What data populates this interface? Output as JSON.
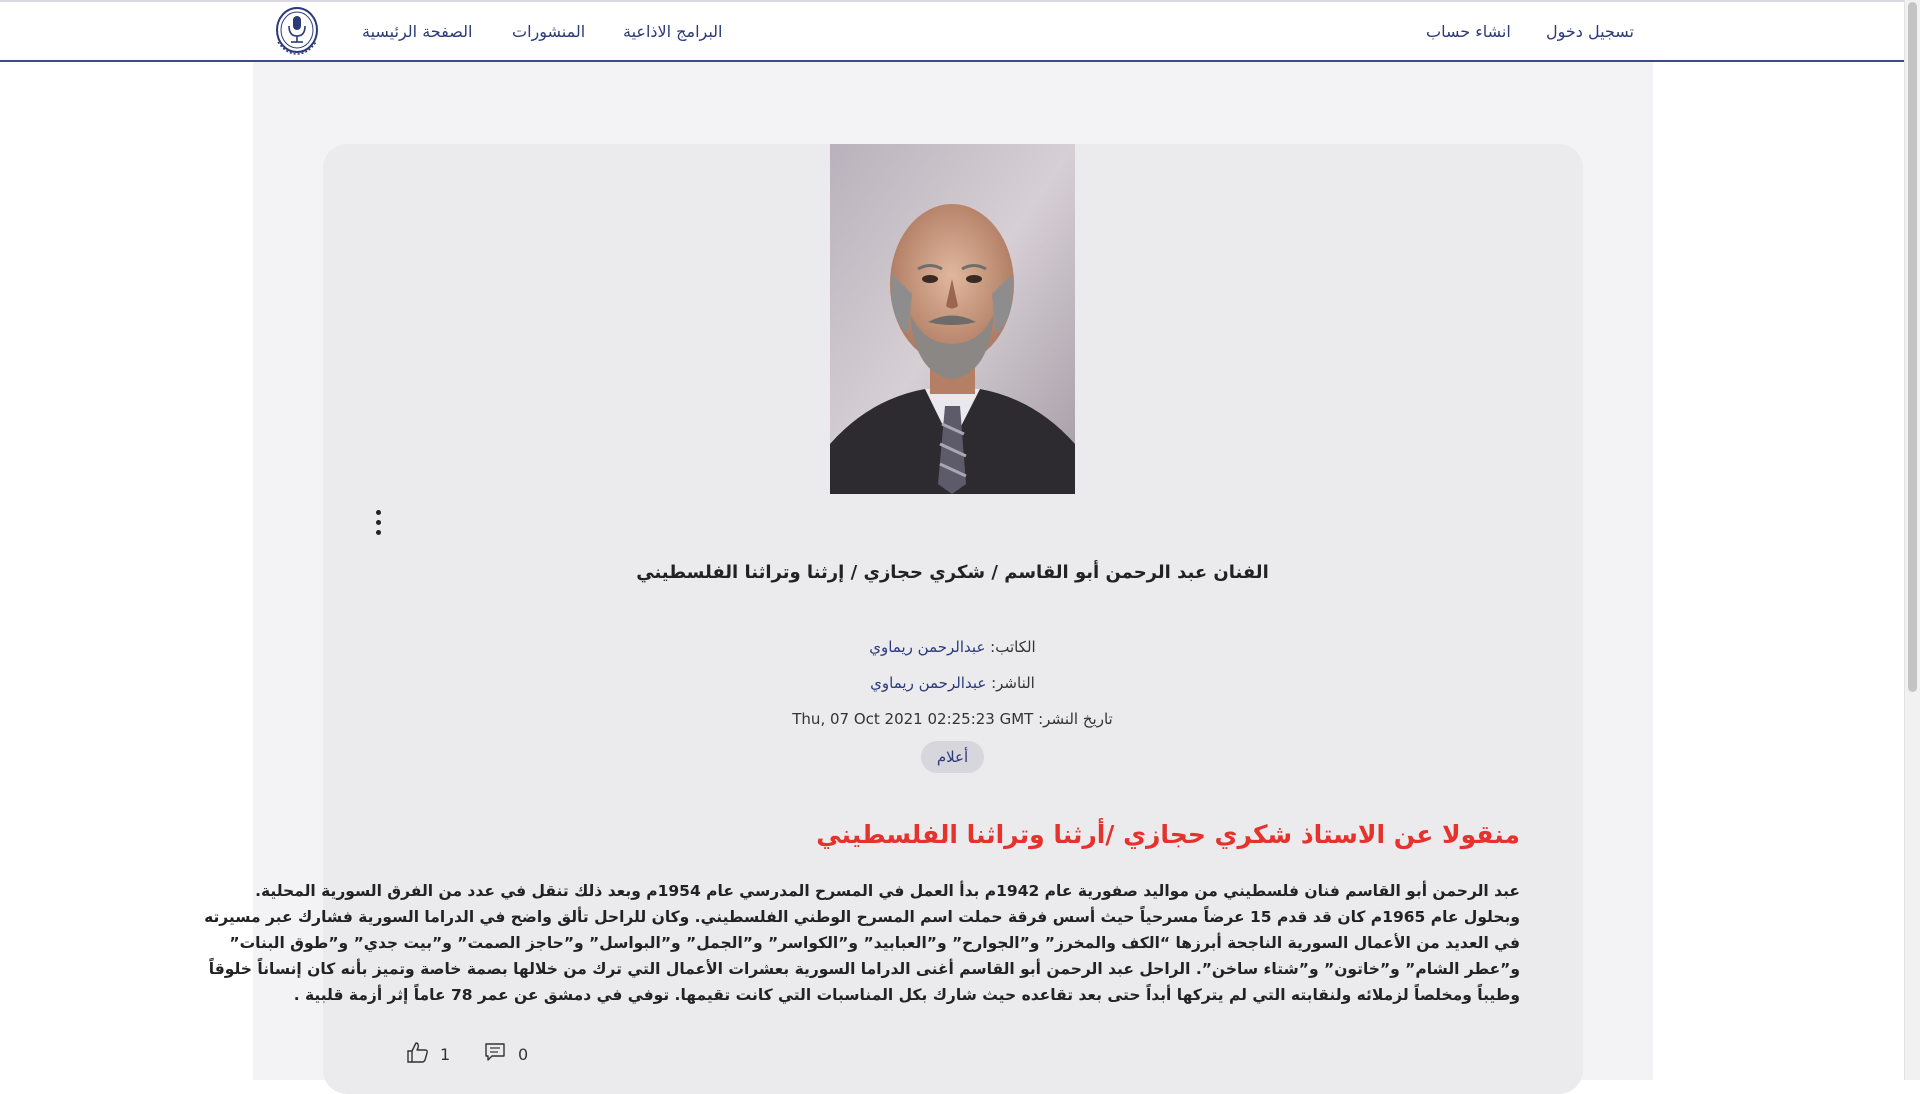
{
  "nav": {
    "home": "الصفحة الرئيسية",
    "posts": "المنشورات",
    "radio": "البرامج الاذاعية",
    "signup": "انشاء حساب",
    "login": "تسجيل دخول",
    "logo_icon": "radio-microphone-emblem-icon"
  },
  "post": {
    "title": "الفنان عبد الرحمن أبو القاسم / شكري حجازي / إرثنا وتراثنا الفلسطيني",
    "author_label": "الكاتب:",
    "author_name": "عبدالرحمن ريماوي",
    "publisher_label": "الناشر:",
    "publisher_name": "عبدالرحمن ريماوي",
    "date_label": "تاريخ النشر:",
    "date_value": "Thu, 07 Oct 2021 02:25:23 GMT",
    "tag": "أعلام",
    "headline": "منقولا عن الاستاذ شكري حجازي /أرثنا وتراثنا الفلسطيني",
    "body_lines": [
      "عبد الرحمن أبو القاسم فنان فلسطيني من مواليد صفورية عام 1942م بدأ العمل في المسرح المدرسي عام 1954م وبعد ذلك تنقل في عدد من الفرق السورية المحلية.",
      "وبحلول عام 1965م كان قد قدم 15 عرضاً مسرحياً حيث أسس فرقة حملت اسم المسرح الوطني الفلسطيني. وكان للراحل تألق واضح في الدراما السورية فشارك عبر مسيرته",
      "في العديد من الأعمال السورية الناجحة أبرزها “الكف والمخرز” و”الجوارح” و”العبابيد” و”الكواسر” و”الجمل” و”البواسل” و”حاجز الصمت” و”بيت جدي” و”طوق البنات”",
      "و”عطر الشام” و”خاتون” و”شتاء ساخن”. الراحل عبد الرحمن أبو القاسم أغنى الدراما السورية بعشرات الأعمال التي ترك من خلالها بصمة خاصة وتميز بأنه كان إنساناً خلوقاً",
      "وطيباً ومخلصاً لزملائه ولنقابته التي لم يتركها أبداً حتى بعد تقاعده حيث شارك بكل المناسبات التي كانت تقيمها. توفي في دمشق عن عمر 78 عاماً إثر أزمة قلبية ."
    ],
    "likes": "1",
    "comments": "0",
    "like_icon": "thumbs-up-icon",
    "comment_icon": "comment-icon",
    "menu_icon": "kebab-menu-icon",
    "photo": "portrait-photo-elderly-man-suit"
  },
  "colors": {
    "brand_navy": "#2c3a7a",
    "headline_red": "#e5322d",
    "card_bg": "#ebebee",
    "page_bg": "#f3f3f6"
  }
}
